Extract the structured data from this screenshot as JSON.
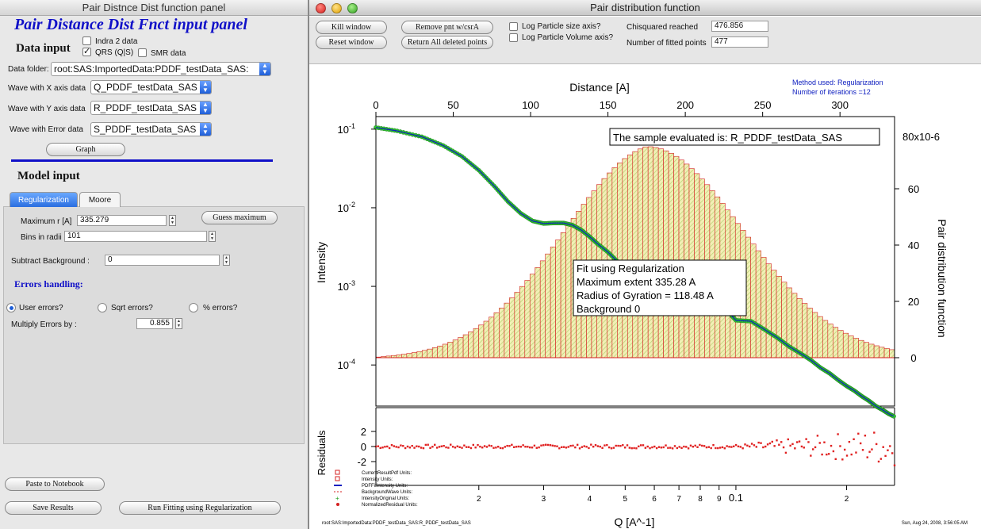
{
  "left_panel": {
    "window_title": "Pair Distnce Dist function panel",
    "heading": "Pair Distance Dist Fnct input panel",
    "data_input_label": "Data input",
    "checkboxes": [
      {
        "label": "Indra 2 data",
        "checked": false
      },
      {
        "label": "QRS (Q|S)",
        "checked": true
      },
      {
        "label": "SMR data",
        "checked": false
      }
    ],
    "data_folder_label": "Data folder:",
    "data_folder_value": "root:SAS:ImportedData:PDDF_testData_SAS:",
    "x_wave_label": "Wave with X axis data",
    "x_wave_value": "Q_PDDF_testData_SAS",
    "y_wave_label": "Wave with Y axis data",
    "y_wave_value": "R_PDDF_testData_SAS",
    "err_wave_label": "Wave with Error data",
    "err_wave_value": "S_PDDF_testData_SAS",
    "graph_button": "Graph",
    "model_input_label": "Model input",
    "tabs": [
      "Regularization",
      "Moore"
    ],
    "active_tab": "Regularization",
    "max_r_label": "Maximum r [A]",
    "max_r_value": "335.279",
    "guess_max_button": "Guess maximum",
    "bins_label": "Bins in radii",
    "bins_value": "101",
    "subtract_bg_label": "Subtract Background   :",
    "subtract_bg_value": "0",
    "errors_heading": "Errors handling:",
    "error_options": [
      {
        "label": "User errors?",
        "selected": true
      },
      {
        "label": "Sqrt errors?",
        "selected": false
      },
      {
        "label": "% errors?",
        "selected": false
      }
    ],
    "multiply_label": "Multiply Errors by :",
    "multiply_value": "0.855",
    "paste_button": "Paste to Notebook",
    "save_button": "Save Results",
    "run_button": "Run Fitting using Regularization"
  },
  "graph_window": {
    "title": "Pair distribution function",
    "kill_button": "Kill window",
    "reset_button": "Reset window",
    "remove_button": "Remove pnt w/csrA",
    "return_button": "Return All deleted points",
    "log_size_label": "Log Particle size axis?",
    "log_volume_label": "Log Particle Volume axis?",
    "chisq_label": "Chisquared reached",
    "chisq_value": "476.856",
    "fitted_label": "Number of fitted points",
    "fitted_value": "477",
    "method_line1": "Method used: Regularization",
    "method_line2": "Number of iterations =12",
    "sample_box": "The sample evaluated is:  R_PDDF_testData_SAS",
    "fit_box": [
      "Fit using Regularization",
      "Maximum extent 335.28  A",
      "Radius of Gyration = 118.48  A",
      "Background 0"
    ],
    "legend": [
      {
        "label": "CurrentResultPdf   Units:",
        "color": "#d42020",
        "marker": "square"
      },
      {
        "label": "Intensity   Units:",
        "color": "#d42020",
        "marker": "square"
      },
      {
        "label": "PDFFitIntensity   Units:",
        "color": "#1020c0",
        "marker": "line"
      },
      {
        "label": "BackgroundWave   Units:",
        "color": "#d42020",
        "marker": "dash"
      },
      {
        "label": "IntensityOriginal   Units:",
        "color": "#20a020",
        "marker": "plus"
      },
      {
        "label": "NormalizedResidual   Units:",
        "color": "#d42020",
        "marker": "dot"
      }
    ],
    "footer_left": "root:SAS:ImportedData:PDDF_testData_SAS:R_PDDF_testData_SAS",
    "footer_right": "Sun, Aug 24, 2008, 3:56:05 AM",
    "colors": {
      "bars_fill": "#f2efb6",
      "bars_hatch": "#b8d070",
      "bars_edge": "#d42020",
      "data_points": "#30c030",
      "fit_line": "#1020c0",
      "residuals": "#e02020"
    }
  },
  "chart_data": {
    "type": "bar",
    "title": "",
    "pdf_histogram": {
      "xlabel": "Distance [A]",
      "ylabel": "Pair distribution function",
      "xlim": [
        0,
        335.28
      ],
      "ylim": [
        0,
        80
      ],
      "x_ticks": [
        0,
        50,
        100,
        150,
        200,
        250,
        300
      ],
      "y_ticks": [
        0,
        20,
        40,
        60
      ],
      "y_top_label": "80x10^-6",
      "y_units": "1e-6",
      "bins": 101,
      "peak_x": 175,
      "peak_y": 75,
      "r_max": 335.28
    },
    "intensity": {
      "type": "scatter",
      "xlabel": "Q [A^-1]",
      "ylabel": "Intensity",
      "xscale": "log",
      "yscale": "log",
      "xlim": [
        0.0105,
        0.27
      ],
      "ylim": [
        3e-05,
        0.12
      ],
      "y_ticks": [
        "10^-1",
        "10^-2",
        "10^-3",
        "10^-4"
      ],
      "x_tick_labels": [
        "2",
        "3",
        "4",
        "5",
        "6",
        "7",
        "8",
        "9",
        "0.1",
        "2"
      ],
      "x": [
        0.0105,
        0.012,
        0.014,
        0.016,
        0.018,
        0.02,
        0.022,
        0.024,
        0.026,
        0.028,
        0.03,
        0.032,
        0.034,
        0.036,
        0.038,
        0.04,
        0.042,
        0.045,
        0.048,
        0.052,
        0.056,
        0.06,
        0.065,
        0.07,
        0.075,
        0.08,
        0.085,
        0.09,
        0.095,
        0.1,
        0.11,
        0.12,
        0.13,
        0.14,
        0.15,
        0.16,
        0.17,
        0.18,
        0.19,
        0.2,
        0.21,
        0.22,
        0.23,
        0.24,
        0.25,
        0.26,
        0.27
      ],
      "y": [
        0.105,
        0.095,
        0.08,
        0.062,
        0.045,
        0.03,
        0.019,
        0.012,
        0.0085,
        0.0068,
        0.0063,
        0.0064,
        0.0064,
        0.006,
        0.0052,
        0.0043,
        0.0035,
        0.0027,
        0.002,
        0.0016,
        0.00135,
        0.0012,
        0.00105,
        0.00085,
        0.00068,
        0.00063,
        0.00064,
        0.0006,
        0.00048,
        0.00037,
        0.00036,
        0.00028,
        0.00022,
        0.00017,
        0.00014,
        0.000115,
        9.2e-05,
        7.8e-05,
        6.4e-05,
        5.4e-05,
        4.7e-05,
        4e-05,
        3.5e-05,
        3e-05,
        2.7e-05,
        2.4e-05,
        2.2e-05
      ]
    },
    "residuals": {
      "type": "scatter",
      "ylabel": "Residuals",
      "ylim": [
        -3,
        3
      ],
      "y_ticks": [
        2,
        0,
        -2
      ]
    }
  }
}
